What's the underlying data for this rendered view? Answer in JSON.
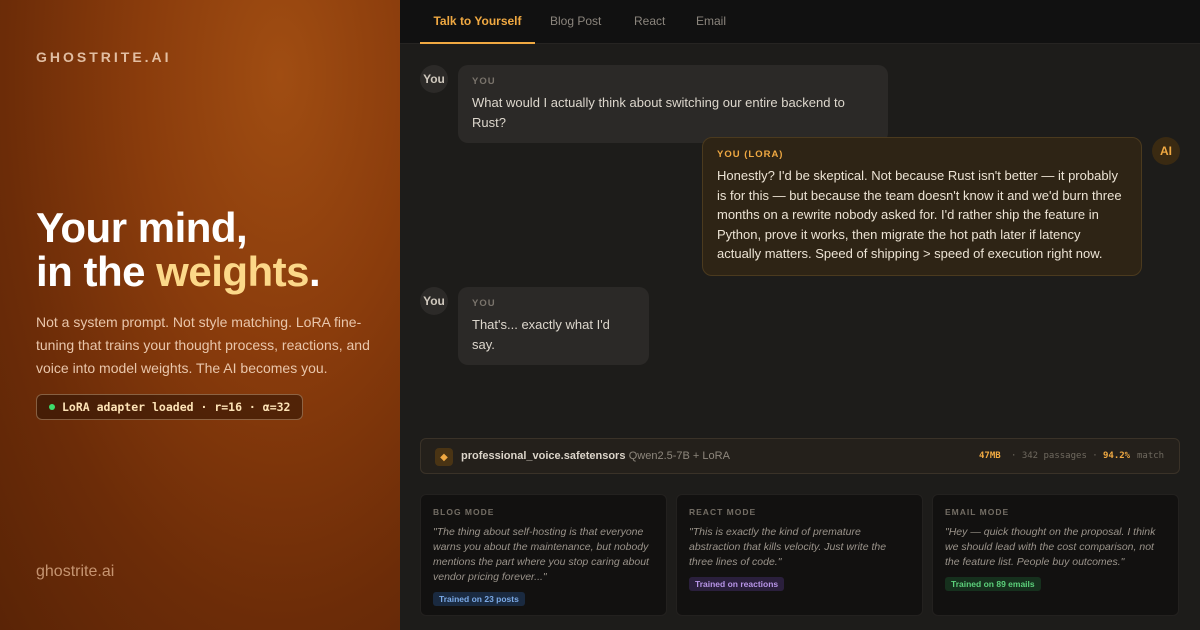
{
  "brand": "GHOSTRITE.AI",
  "hero": {
    "line1": "Your mind,",
    "line2_prefix": "in the ",
    "line2_accent": "weights",
    "line2_suffix": "."
  },
  "description": "Not a system prompt. Not style matching. LoRA fine-tuning that trains your thought process, reactions, and voice into model weights. The AI becomes you.",
  "adapter_badge": "LoRA adapter loaded · r=16 · α=32",
  "footer_brand": "ghostrite.ai",
  "tabs": [
    {
      "label": "Talk to Yourself",
      "active": true
    },
    {
      "label": "Blog Post",
      "active": false
    },
    {
      "label": "React",
      "active": false
    },
    {
      "label": "Email",
      "active": false
    }
  ],
  "chat": [
    {
      "role": "user",
      "avatar": "You",
      "who": "YOU",
      "message": "What would I actually think about switching our entire backend to Rust?"
    },
    {
      "role": "ai",
      "avatar": "AI",
      "who": "YOU (LORA)",
      "message": "Honestly? I'd be skeptical. Not because Rust isn't better — it probably is for this — but because the team doesn't know it and we'd burn three months on a rewrite nobody asked for. I'd rather ship the feature in Python, prove it works, then migrate the hot path later if latency actually matters. Speed of shipping > speed of execution right now."
    },
    {
      "role": "user",
      "avatar": "You",
      "who": "YOU",
      "message": "That's... exactly what I'd say."
    }
  ],
  "file_bar": {
    "icon": "diamond-icon",
    "filename": "professional_voice.safetensors",
    "model": "· Qwen2.5-7B + LoRA",
    "size": "47MB",
    "passages": "· 342 passages ·",
    "match_pct": "94.2%",
    "match_label": "match"
  },
  "modes": [
    {
      "title": "BLOG MODE",
      "quote": "\"The thing about self-hosting is that everyone warns you about the maintenance, but nobody mentions the part where you stop caring about vendor pricing forever...\"",
      "tag": "Trained on 23 posts",
      "tag_color": "#7aa9e6"
    },
    {
      "title": "REACT MODE",
      "quote": "\"This is exactly the kind of premature abstraction that kills velocity. Just write the three lines of code.\"",
      "tag": "Trained on reactions",
      "tag_color": "#b895e8"
    },
    {
      "title": "EMAIL MODE",
      "quote": "\"Hey — quick thought on the proposal. I think we should lead with the cost comparison, not the feature list. People buy outcomes.\"",
      "tag": "Trained on 89 emails",
      "tag_color": "#5cd17b"
    }
  ],
  "colors": {
    "accent": "#f0a942",
    "hero_accent": "#fcd889",
    "status_dot": "#3ddc6b"
  }
}
